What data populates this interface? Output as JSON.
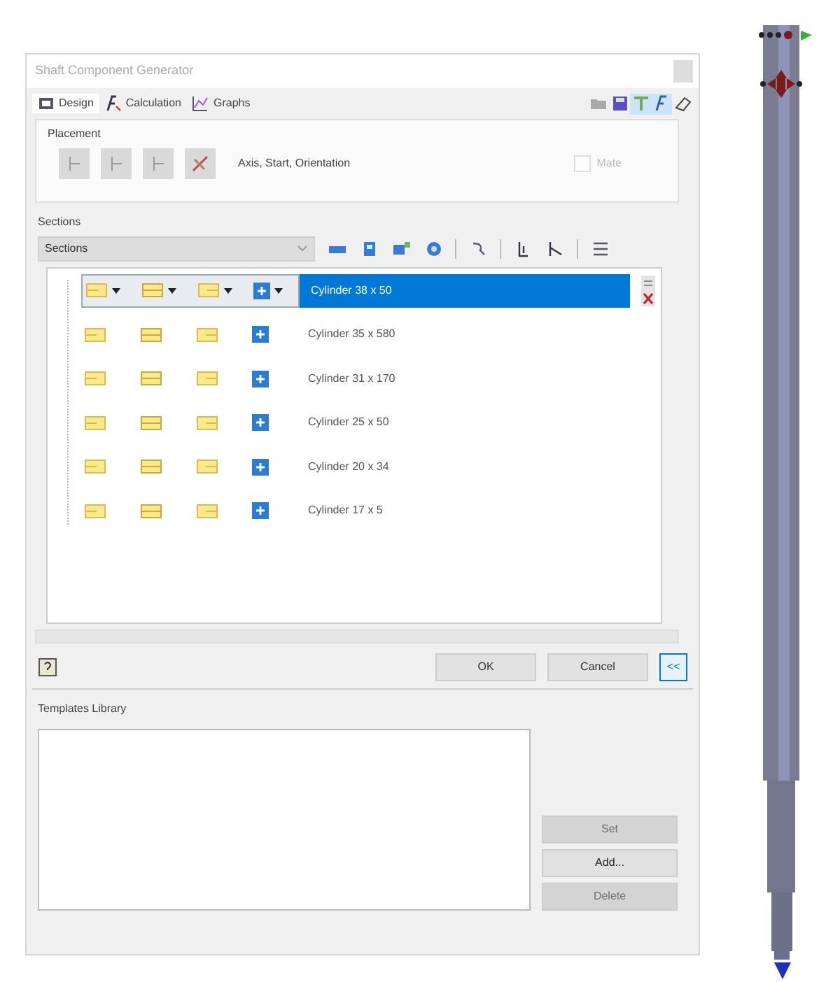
{
  "window": {
    "title": "Shaft Component Generator"
  },
  "tabs": [
    {
      "label": "Design",
      "selected": true
    },
    {
      "label": "Calculation",
      "selected": false
    },
    {
      "label": "Graphs",
      "selected": false
    }
  ],
  "toolbar": [
    {
      "pressed": false
    },
    {
      "pressed": false
    },
    {
      "pressed": true
    },
    {
      "pressed": true
    },
    {
      "pressed": false
    }
  ],
  "placement": {
    "title": "Placement",
    "summary": "Axis, Start, Orientation",
    "mate": {
      "label": "Mate",
      "checked": false,
      "disabled": true
    }
  },
  "sections": {
    "title": "Sections",
    "dropdown": "Sections",
    "rows": [
      {
        "label": "Cylinder 38 x 50",
        "selected": true
      },
      {
        "label": "Cylinder 35 x 580",
        "selected": false
      },
      {
        "label": "Cylinder 31 x 170",
        "selected": false
      },
      {
        "label": "Cylinder 25 x 50",
        "selected": false
      },
      {
        "label": "Cylinder 20 x 34",
        "selected": false
      },
      {
        "label": "Cylinder 17 x 5",
        "selected": false
      }
    ]
  },
  "footer_buttons": [
    {
      "label": "OK",
      "pressed": false
    },
    {
      "label": "Cancel",
      "pressed": false
    },
    {
      "label": "<<",
      "pressed": true
    }
  ],
  "templates": {
    "title": "Templates Library",
    "buttons": [
      {
        "label": "Set",
        "disabled": true
      },
      {
        "label": "Add...",
        "disabled": false
      },
      {
        "label": "Delete",
        "disabled": true
      }
    ]
  }
}
